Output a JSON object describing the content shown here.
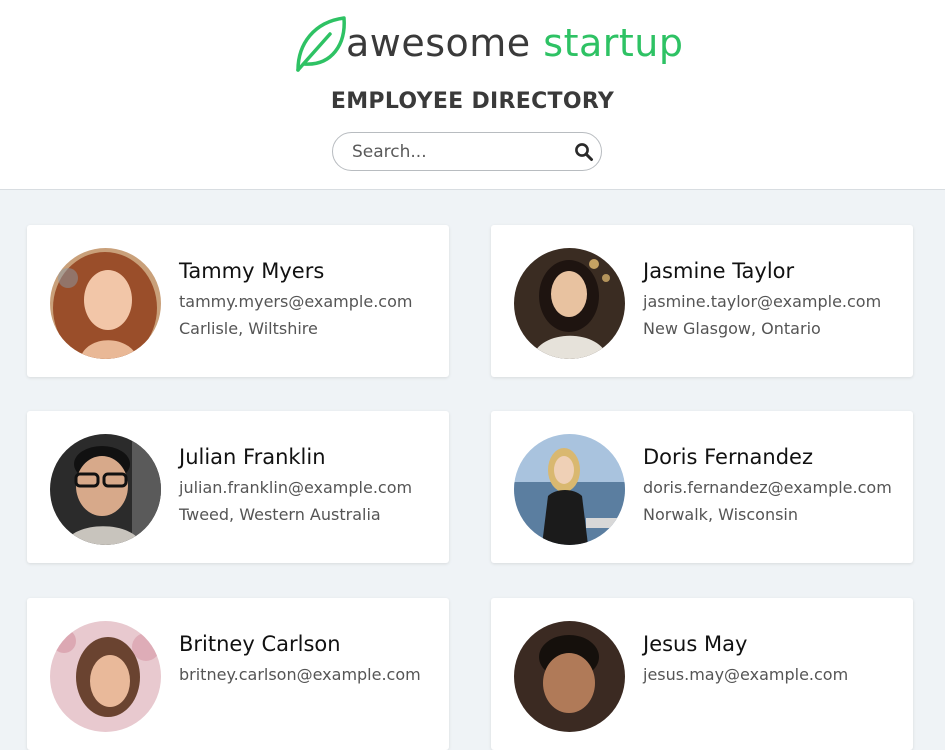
{
  "brand": {
    "word1": "awesome",
    "word2": "startup",
    "accent_color": "#2ec264",
    "leaf_icon": "leaf-icon"
  },
  "page": {
    "title": "EMPLOYEE DIRECTORY"
  },
  "search": {
    "placeholder": "Search...",
    "value": "",
    "icon": "search-icon"
  },
  "employees": [
    {
      "name": "Tammy Myers",
      "email": "tammy.myers@example.com",
      "location": "Carlisle, Wiltshire"
    },
    {
      "name": "Jasmine Taylor",
      "email": "jasmine.taylor@example.com",
      "location": "New Glasgow, Ontario"
    },
    {
      "name": "Julian Franklin",
      "email": "julian.franklin@example.com",
      "location": "Tweed, Western Australia"
    },
    {
      "name": "Doris Fernandez",
      "email": "doris.fernandez@example.com",
      "location": "Norwalk, Wisconsin"
    },
    {
      "name": "Britney Carlson",
      "email": "britney.carlson@example.com",
      "location": ""
    },
    {
      "name": "Jesus May",
      "email": "jesus.may@example.com",
      "location": ""
    }
  ]
}
